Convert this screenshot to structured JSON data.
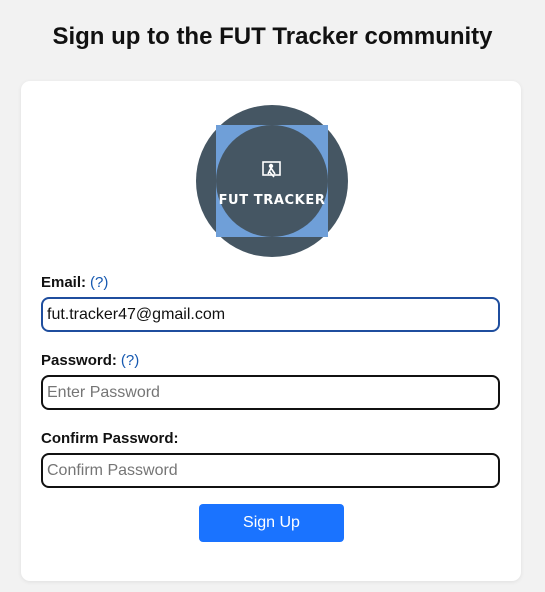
{
  "page": {
    "title": "Sign up to the FUT Tracker community"
  },
  "logo": {
    "text": "FUT TRACKER",
    "circle_color": "#455663",
    "square_color": "#6f9fd8"
  },
  "form": {
    "email": {
      "label": "Email:",
      "help": "(?)",
      "value": "fut.tracker47@gmail.com"
    },
    "password": {
      "label": "Password:",
      "help": "(?)",
      "placeholder": "Enter Password"
    },
    "confirm_password": {
      "label": "Confirm Password:",
      "placeholder": "Confirm Password"
    },
    "submit_label": "Sign Up"
  },
  "colors": {
    "accent": "#1a73ff",
    "link": "#1558b0",
    "focus_border": "#1f4e9e"
  }
}
